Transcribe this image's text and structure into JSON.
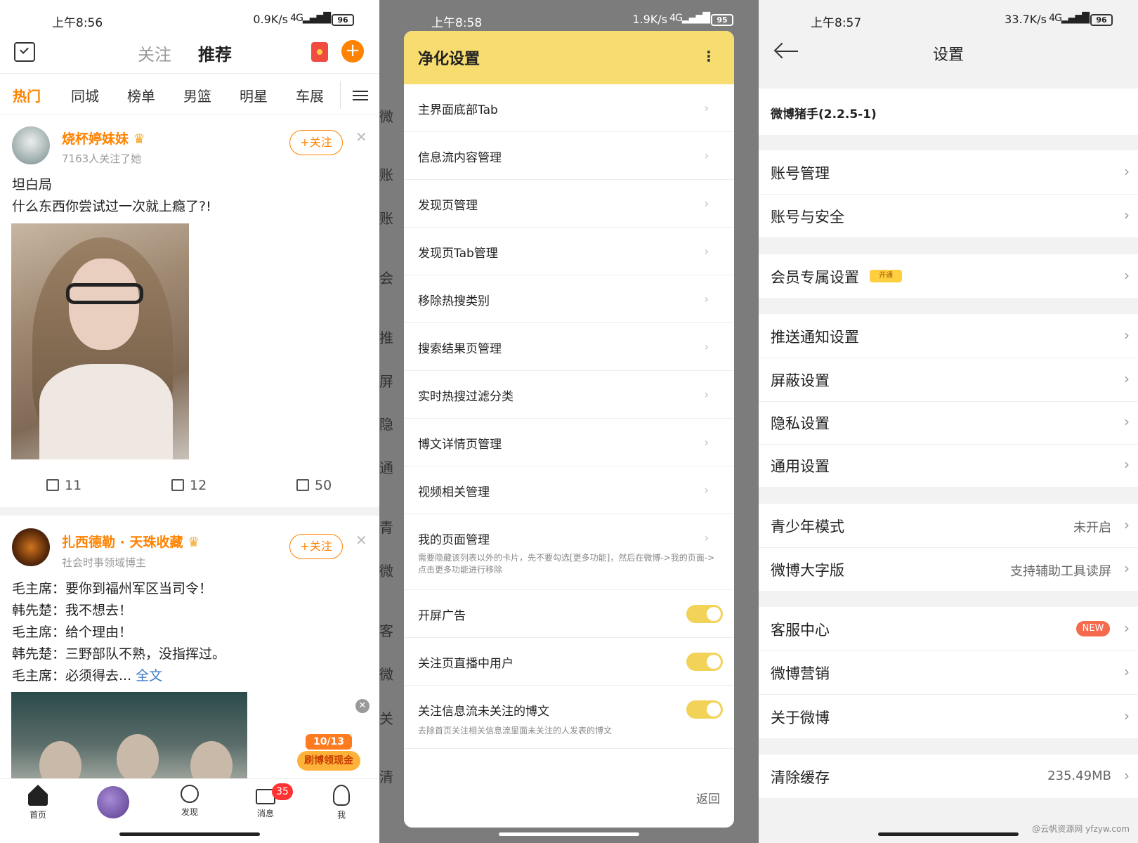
{
  "left": {
    "status": {
      "time": "上午8:56",
      "speed": "0.9K/s",
      "signal": "4G",
      "battery": "96"
    },
    "top_tabs": [
      "关注",
      "推荐"
    ],
    "channels": [
      "热门",
      "同城",
      "榜单",
      "男篮",
      "明星",
      "车展"
    ],
    "post1": {
      "user": "烧杯婷妹妹",
      "sub": "7163人关注了她",
      "follow": "+关注",
      "lines": [
        "坦白局",
        "什么东西你尝试过一次就上瘾了?!"
      ],
      "repost": "11",
      "comment": "12",
      "like": "50"
    },
    "post2": {
      "user": "扎西德勒 · 天珠收藏",
      "sub": "社会时事领域博主",
      "follow": "+关注",
      "lines": [
        "毛主席：要你到福州军区当司令！",
        "韩先楚：我不想去！",
        "毛主席：给个理由！",
        "韩先楚：三野部队不熟，没指挥过。",
        "毛主席：必须得去..."
      ],
      "more": "全文"
    },
    "badge": {
      "date": "10/13",
      "text": "刷博领现金"
    },
    "nav": [
      "首页",
      "发现",
      "消息",
      "我"
    ],
    "unread": "35"
  },
  "mid": {
    "status": {
      "time": "上午8:58",
      "speed": "1.9K/s",
      "signal": "4G",
      "battery": "95"
    },
    "bg_rows": [
      "微",
      "账",
      "账",
      "会",
      "推",
      "屏",
      "隐",
      "通",
      "青",
      "微",
      "客",
      "微",
      "关",
      "清"
    ],
    "dialog": {
      "title": "净化设置",
      "items": [
        "主界面底部Tab",
        "信息流内容管理",
        "发现页管理",
        "发现页Tab管理",
        "移除热搜类别",
        "搜索结果页管理",
        "实时热搜过滤分类",
        "博文详情页管理",
        "视频相关管理",
        "我的页面管理"
      ],
      "my_page_desc": "需要隐藏该列表以外的卡片，先不要勾选[更多功能]，然后在微博->我的页面->点击更多功能进行移除",
      "toggles": [
        "开屏广告",
        "关注页直播中用户",
        "关注信息流未关注的博文"
      ],
      "toggle_desc": "去除首页关注相关信息流里面未关注的人发表的博文",
      "back": "返回"
    }
  },
  "right": {
    "status": {
      "time": "上午8:57",
      "speed": "33.7K/s",
      "signal": "4G",
      "battery": "96"
    },
    "title": "设置",
    "plugin": "微博猪手(2.2.5-1)",
    "rows": {
      "account": "账号管理",
      "security": "账号与安全",
      "vip": "会员专属设置",
      "vip_tag": "开通",
      "push": "推送通知设置",
      "block": "屏蔽设置",
      "privacy": "隐私设置",
      "general": "通用设置",
      "teen": "青少年模式",
      "teen_val": "未开启",
      "bigfont": "微博大字版",
      "bigfont_val": "支持辅助工具读屏",
      "service": "客服中心",
      "service_tag": "NEW",
      "marketing": "微博营销",
      "about": "关于微博",
      "cache": "清除缓存",
      "cache_val": "235.49MB"
    },
    "watermark": "@云帆资源网 yfzyw.com"
  }
}
